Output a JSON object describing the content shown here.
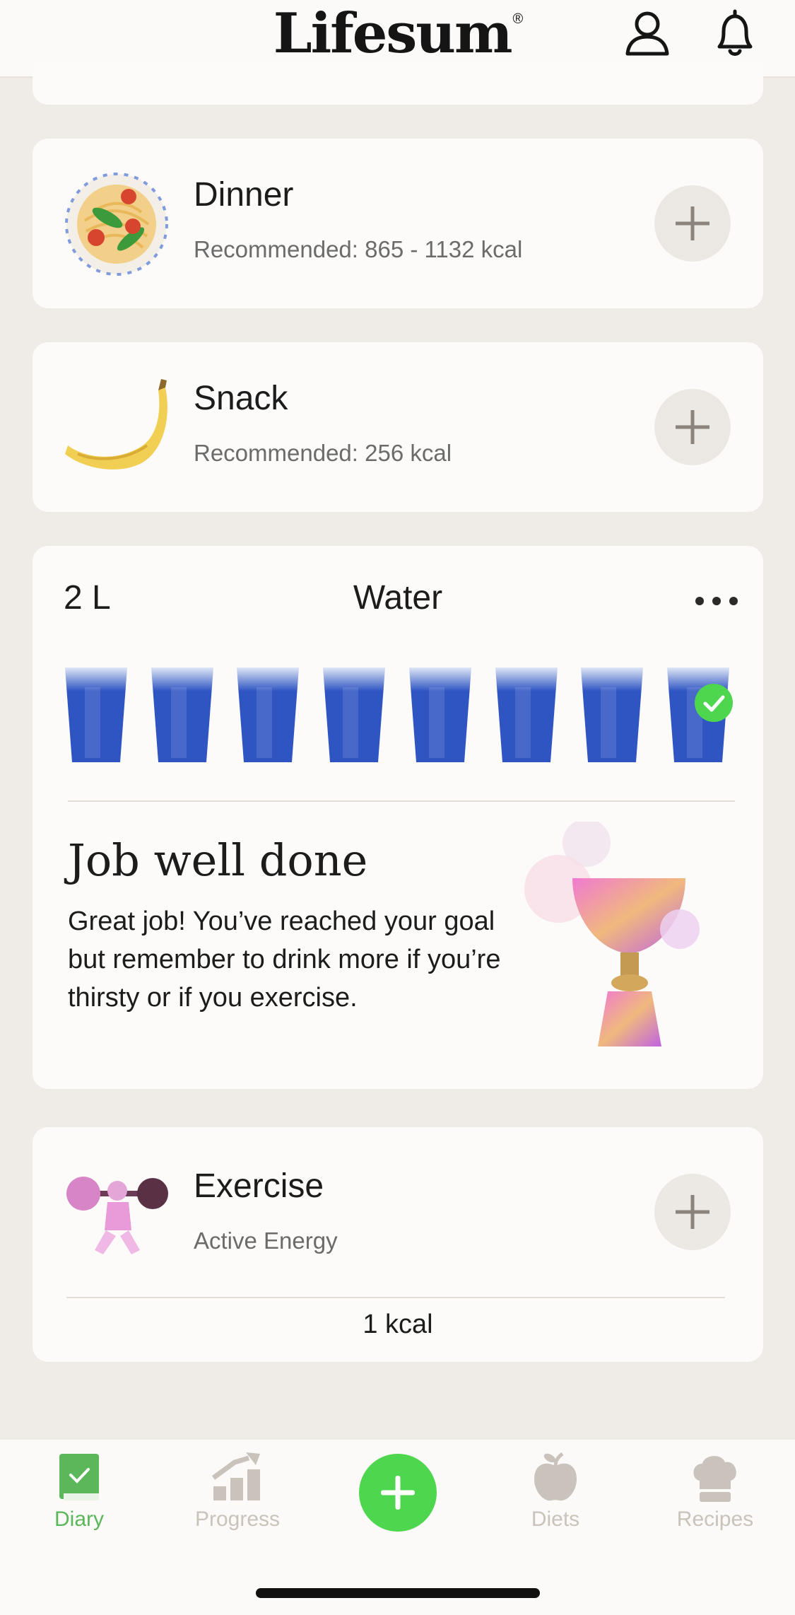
{
  "header": {
    "logo": "Lifesum",
    "logo_mark": "®",
    "icons": [
      "profile-icon",
      "bell-icon"
    ]
  },
  "meals": [
    {
      "title": "Dinner",
      "subtitle": "Recommended: 865 - 1132  kcal",
      "image": "pasta-plate"
    },
    {
      "title": "Snack",
      "subtitle": "Recommended: 256  kcal",
      "image": "banana"
    }
  ],
  "water": {
    "amount": "2 L",
    "title": "Water",
    "glasses_total": 8,
    "glasses_filled": 8,
    "done_title": "Job well done",
    "done_text": "Great job! You’ve reached your goal but remember to drink more if you’re thirsty or if you exercise."
  },
  "exercise": {
    "title": "Exercise",
    "subtitle": "Active Energy",
    "kcal": "1 kcal"
  },
  "nav": {
    "items": [
      {
        "label": "Diary",
        "icon": "diary-icon",
        "active": true
      },
      {
        "label": "Progress",
        "icon": "progress-icon",
        "active": false
      },
      {
        "label": "Diets",
        "icon": "apple-icon",
        "active": false
      },
      {
        "label": "Recipes",
        "icon": "chef-hat-icon",
        "active": false
      }
    ]
  },
  "colors": {
    "accent": "#4fd64f",
    "active_label": "#5bb759",
    "background": "#efebe6",
    "card": "#fcfbfa",
    "water": "#2f55c2"
  }
}
